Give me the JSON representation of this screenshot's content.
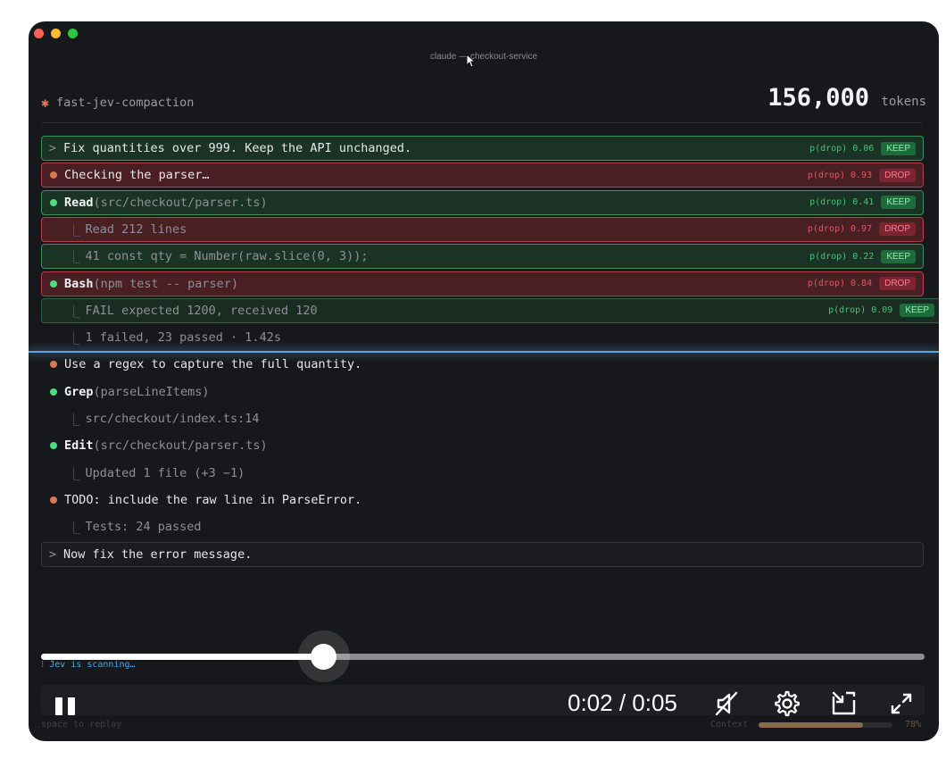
{
  "window": {
    "title": "claude — checkout-service"
  },
  "header": {
    "star": "✱",
    "project": "fast-jev-compaction",
    "tokens_value": "156,000",
    "tokens_label": "tokens"
  },
  "rows": [
    {
      "kind": "prompt",
      "text": "Fix quantities over 999. Keep the API unchanged.",
      "pdrop": "p(drop) 0.06",
      "tag": "KEEP",
      "state": "keep"
    },
    {
      "kind": "message",
      "text": "Checking the parser…",
      "pdrop": "p(drop) 0.93",
      "tag": "DROP",
      "state": "drop"
    },
    {
      "kind": "tool",
      "name": "Read",
      "args": "(src/checkout/parser.ts)",
      "pdrop": "p(drop) 0.41",
      "tag": "KEEP",
      "state": "keep"
    },
    {
      "kind": "result",
      "text": "Read 212 lines",
      "pdrop": "p(drop) 0.97",
      "tag": "DROP",
      "state": "drop"
    },
    {
      "kind": "result",
      "text": "41  const qty = Number(raw.slice(0, 3));",
      "pdrop": "p(drop) 0.22",
      "tag": "KEEP",
      "state": "keep"
    },
    {
      "kind": "tool",
      "name": "Bash",
      "args": "(npm test -- parser)",
      "pdrop": "p(drop) 0.84",
      "tag": "DROP",
      "state": "drop"
    },
    {
      "kind": "result",
      "text": "FAIL  expected 1200, received 120",
      "pdrop": "p(drop) 0.09",
      "tag": "KEEP",
      "state": "keep-faded"
    },
    {
      "kind": "result",
      "text": "1 failed, 23 passed · 1.42s"
    },
    {
      "kind": "message",
      "text": "Use a regex to capture the full quantity."
    },
    {
      "kind": "tool",
      "name": "Grep",
      "args": "(parseLineItems)"
    },
    {
      "kind": "result",
      "text": "src/checkout/index.ts:14"
    },
    {
      "kind": "tool",
      "name": "Edit",
      "args": "(src/checkout/parser.ts)"
    },
    {
      "kind": "result",
      "text": "Updated 1 file (+3 −1)"
    },
    {
      "kind": "message",
      "text": "TODO: include the raw line in ParseError."
    },
    {
      "kind": "result",
      "text": "Tests: 24 passed"
    },
    {
      "kind": "prompt",
      "text": "Now fix the error message."
    }
  ],
  "status": {
    "scanning": "⁝ Jev is scanning…"
  },
  "player": {
    "time": "0:02 / 0:05",
    "progress": 0.32,
    "mute_icon": "speaker-muted-icon",
    "settings_icon": "gear-icon",
    "pip_icon": "picture-in-picture-icon",
    "fullscreen_icon": "fullscreen-icon"
  },
  "footer": {
    "hint": "space to replay",
    "context_label": "Context",
    "context_value": 0.78,
    "context_pct": "78%"
  },
  "colors": {
    "keep": "#4ac07a",
    "drop": "#e0566a",
    "accent": "#d97757",
    "scan": "#5aa5e6"
  }
}
